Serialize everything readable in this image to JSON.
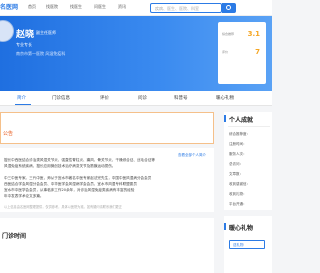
{
  "nav": {
    "brand": "名医网",
    "items": [
      "首页",
      "找医院",
      "找医生",
      "问医生",
      "资讯"
    ],
    "search_placeholder": "疾病、医生、医院、科室"
  },
  "doctor": {
    "name": "赵晓",
    "title": "副主任医师",
    "dept": "专业专长",
    "hospital": "南京市第一医院 风湿免疫科"
  },
  "stats": [
    {
      "label": "综合推荐",
      "value": "3.1"
    },
    {
      "label": "评价",
      "value": "7"
    }
  ],
  "tabs": [
    "简介",
    "门诊信息",
    "评价",
    "问诊",
    "科普号",
    "暖心礼物"
  ],
  "notice": {
    "text": "公告"
  },
  "intro": {
    "more": "查看全部个人简介",
    "lines": [
      "擅长中西医结合诊治类风湿关节炎、强直性脊柱炎、痛风、骨关节炎、干燥综合征、丝毛合征等",
      "风湿免疫系统疾病，擅长应用微创技术治疗病变关节及筋膜运动损伤。",
      "",
      "中三中医专家。三代中医，师从于宜水市著名中医专家赵法完先生，中国中医风湿病分会会员",
      "西医结合学会风湿分会会员、中华医学会风湿病学会会员、宜水市风湿专科联盟委员",
      "宜水市中医学会会员，从事临床工作20余年，对诊治风湿免疫类疾病有丰富的经验",
      "年中发表学术论文多篇。"
    ],
    "footer": "以上信息由名医网整理提供，仅供参考，具体以医院为准。如有疑问请联系我们更正"
  },
  "schedule": {
    "title": "门诊时间"
  },
  "side": {
    "title": "个人成就",
    "rows": [
      "综合推荐度：",
      "注册时间：",
      "服务人次：",
      "总访问：",
      "文章数：",
      "收到感谢信：",
      "收到礼物：",
      "平台开通："
    ]
  },
  "side2": {
    "title": "暖心礼物",
    "button": "送礼物"
  }
}
